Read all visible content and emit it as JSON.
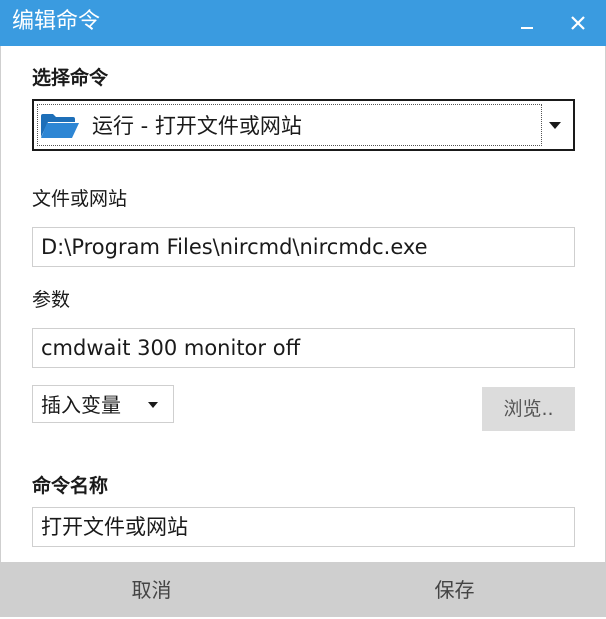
{
  "window": {
    "title": "编辑命令"
  },
  "titlebar": {
    "minimize_icon": "minimize-icon",
    "close_icon": "close-icon"
  },
  "form": {
    "command_label": "选择命令",
    "command_selected": "运行 - 打开文件或网站",
    "command_icon": "folder-open-icon",
    "file_label": "文件或网站",
    "file_value": "D:\\Program Files\\nircmd\\nircmdc.exe",
    "params_label": "参数",
    "params_value": "cmdwait 300 monitor off",
    "insert_var_label": "插入变量",
    "browse_label": "浏览..",
    "name_label": "命令名称",
    "name_value": "打开文件或网站"
  },
  "footer": {
    "cancel_label": "取消",
    "save_label": "保存"
  },
  "colors": {
    "titlebar": "#3a9be0",
    "folder": "#1e6fb8",
    "footer": "#cfcfcf",
    "browse": "#dcdcdc"
  }
}
